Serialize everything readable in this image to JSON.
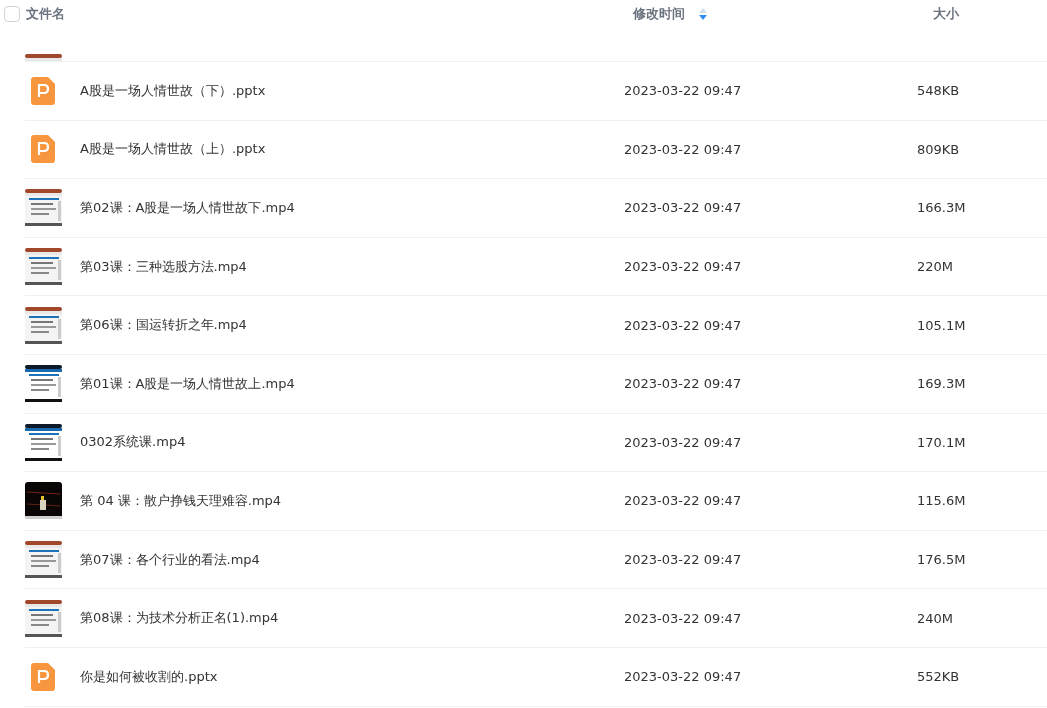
{
  "header": {
    "select_all": {
      "checked": false
    },
    "columns": [
      {
        "label": "文件名",
        "sorted": false
      },
      {
        "label": "修改时间",
        "sorted": true
      },
      {
        "label": "大小",
        "sorted": false
      }
    ]
  },
  "rows": [
    {
      "kind": "video",
      "partial": true
    },
    {
      "kind": "pptx",
      "name": "A股是一场人情世故（下）.pptx",
      "modified": "2023-03-22 09:47",
      "size": "548KB"
    },
    {
      "kind": "pptx",
      "name": "A股是一场人情世故（上）.pptx",
      "modified": "2023-03-22 09:47",
      "size": "809KB"
    },
    {
      "kind": "video",
      "name": "第02课：A股是一场人情世故下.mp4",
      "modified": "2023-03-22 09:47",
      "size": "166.3M"
    },
    {
      "kind": "video",
      "name": "第03课：三种选股方法.mp4",
      "modified": "2023-03-22 09:47",
      "size": "220M"
    },
    {
      "kind": "video",
      "name": "第06课：国运转折之年.mp4",
      "modified": "2023-03-22 09:47",
      "size": "105.1M"
    },
    {
      "kind": "video",
      "name": "第01课：A股是一场人情世故上.mp4",
      "modified": "2023-03-22 09:47",
      "size": "169.3M"
    },
    {
      "kind": "video",
      "name": "0302系统课.mp4",
      "modified": "2023-03-22 09:47",
      "size": "170.1M"
    },
    {
      "kind": "video",
      "name": "第 04 课：散户挣钱天理难容.mp4",
      "modified": "2023-03-22 09:47",
      "size": "115.6M"
    },
    {
      "kind": "video",
      "name": "第07课：各个行业的看法.mp4",
      "modified": "2023-03-22 09:47",
      "size": "176.5M"
    },
    {
      "kind": "video",
      "name": "第08课：为技术分析正名(1).mp4",
      "modified": "2023-03-22 09:47",
      "size": "240M"
    },
    {
      "kind": "pptx",
      "name": "你是如何被收割的.pptx",
      "modified": "2023-03-22 09:47",
      "size": "552KB"
    }
  ]
}
